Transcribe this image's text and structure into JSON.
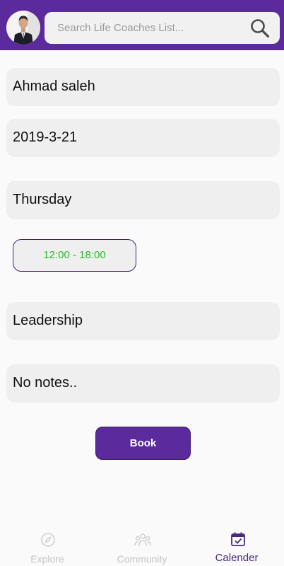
{
  "header": {
    "search_placeholder": "Search Life Coaches List..."
  },
  "booking": {
    "coach_name": "Ahmad saleh",
    "date": "2019-3-21",
    "day": "Thursday",
    "time_slot": "12:00 - 18:00",
    "topic": "Leadership",
    "notes": "No notes..",
    "book_label": "Book"
  },
  "nav": {
    "explore": "Explore",
    "community": "Community",
    "calender": "Calender"
  },
  "colors": {
    "brand": "#5b2a9c",
    "time_slot_text": "#2fb52f"
  }
}
